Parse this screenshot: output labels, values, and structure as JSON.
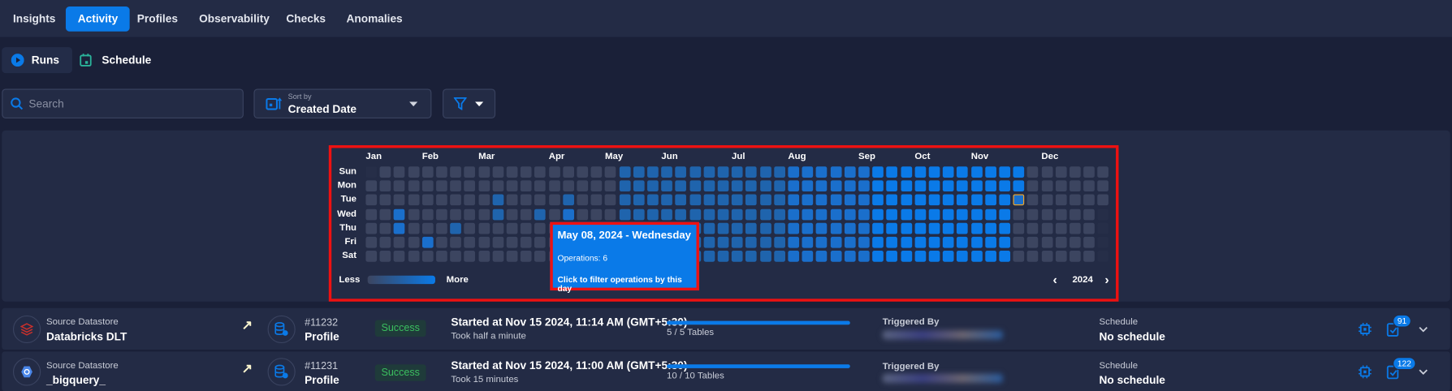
{
  "tabs": [
    "Insights",
    "Activity",
    "Profiles",
    "Observability",
    "Checks",
    "Anomalies"
  ],
  "active_tab": "Activity",
  "subtabs": {
    "runs": "Runs",
    "schedule": "Schedule"
  },
  "search": {
    "placeholder": "Search",
    "value": ""
  },
  "sort": {
    "label": "Sort by",
    "value": "Created Date"
  },
  "colors": {
    "accent": "#0a7ae8",
    "success": "#3bbf5f",
    "today_outline": "#f5a623",
    "highlight": "#ee1111"
  },
  "heatmap": {
    "year": 2024,
    "months": [
      "Jan",
      "Feb",
      "Mar",
      "Apr",
      "May",
      "Jun",
      "Jul",
      "Aug",
      "Sep",
      "Oct",
      "Nov",
      "Dec"
    ],
    "days": [
      "Sun",
      "Mon",
      "Tue",
      "Wed",
      "Thu",
      "Fri",
      "Sat"
    ],
    "level_colors": [
      "#262e48",
      "#3c4560",
      "#1f64ad",
      "#1a6fcc",
      "#0a7ae8",
      "#1a6fcc"
    ],
    "levels": [
      "0111111111111111112222222222223333334444444444",
      "1111111111111111112222222222223333334444444444",
      "1111111112111121112222222222223333334444444444",
      "1131111112112131112222222222223333334444444444",
      "1131112111111111112222222222223333334444444444",
      "1111311111111111112222222222223333334444444444",
      "1111111111111111112222222222223333334444444444"
    ],
    "levels_tail": [
      "4111111",
      "4111111",
      "5111111",
      "1111110",
      "1111110",
      "1111110",
      "1111110"
    ],
    "legend": {
      "less": "Less",
      "more": "More"
    },
    "tooltip": {
      "title": "May 08, 2024 - Wednesday",
      "operations": "Operations: 6",
      "hint": "Click to filter operations by this day"
    }
  },
  "runs": [
    {
      "source_label": "Source Datastore",
      "source": "Databricks DLT",
      "id": "#11232",
      "type": "Profile",
      "status": "Success",
      "started": "Started at Nov 15 2024, 11:14 AM (GMT+5:30)",
      "duration": "Took half a minute",
      "tables": "5 / 5 Tables",
      "progress": 1.0,
      "triggered_label": "Triggered By",
      "schedule_label": "Schedule",
      "schedule": "No schedule",
      "checks_count": "91",
      "source_icon": "databricks-icon"
    },
    {
      "source_label": "Source Datastore",
      "source": "_bigquery_",
      "id": "#11231",
      "type": "Profile",
      "status": "Success",
      "started": "Started at Nov 15 2024, 11:00 AM (GMT+5:30)",
      "duration": "Took 15 minutes",
      "tables": "10 / 10 Tables",
      "progress": 1.0,
      "triggered_label": "Triggered By",
      "schedule_label": "Schedule",
      "schedule": "No schedule",
      "checks_count": "122",
      "source_icon": "bigquery-icon"
    }
  ]
}
